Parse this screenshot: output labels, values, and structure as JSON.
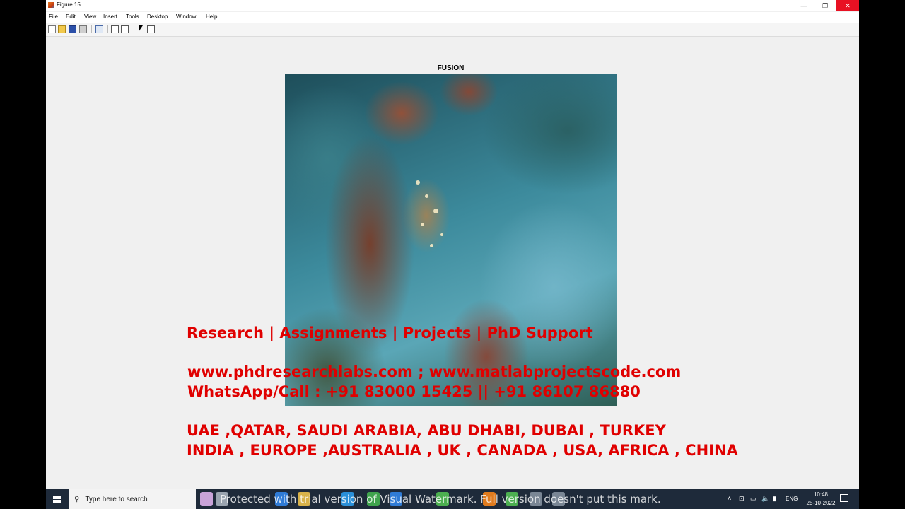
{
  "window": {
    "title": "Figure 15",
    "controls": {
      "minimize": "—",
      "restore": "❐",
      "close": "✕"
    }
  },
  "menu": [
    "File",
    "Edit",
    "View",
    "Insert",
    "Tools",
    "Desktop",
    "Window",
    "Help"
  ],
  "toolbar": {
    "icons": [
      "new-figure-icon",
      "open-file-icon",
      "save-icon",
      "print-icon",
      "link-plot-icon",
      "insert-colorbar-icon",
      "insert-legend-icon",
      "edit-plot-icon",
      "plot-browser-icon"
    ]
  },
  "axes": {
    "title": "FUSION"
  },
  "watermark": {
    "line1": "Research | Assignments | Projects | PhD Support",
    "line2": "www.phdresearchlabs.com ; www.matlabprojectscode.com",
    "line3": "WhatsApp/Call : +91 83000 15425 || +91 86107 86880",
    "line4": "UAE ,QATAR, SAUDI ARABIA, ABU DHABI, DUBAI , TURKEY",
    "line5": "INDIA , EUROPE ,AUSTRALIA , UK , CANADA , USA, AFRICA , CHINA"
  },
  "taskbar": {
    "search_placeholder": "Type here to search",
    "overlay_note": "Protected with trial version of Visual Watermark. Full version doesn't put this mark.",
    "language": "ENG",
    "time": "10:48",
    "date": "25-10-2022",
    "colors": {
      "background": "#1e2a3a"
    }
  }
}
